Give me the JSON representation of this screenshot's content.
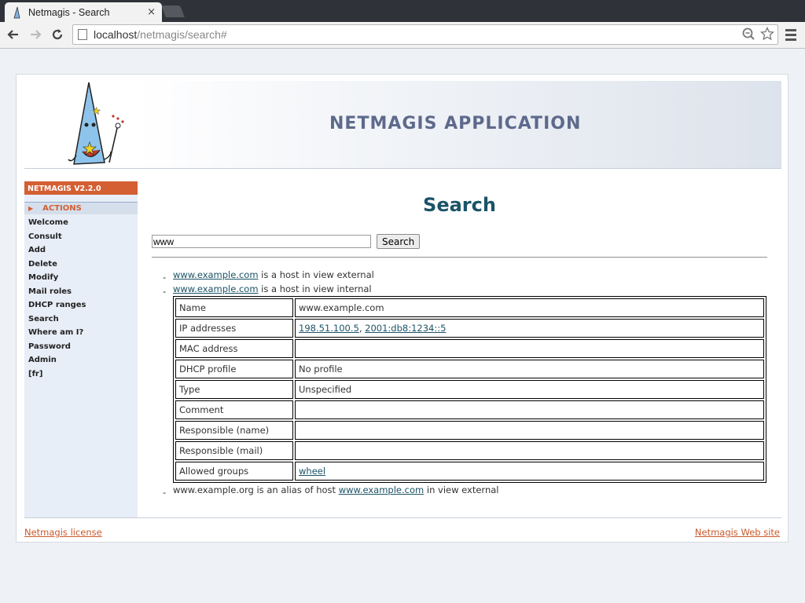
{
  "browser": {
    "tab_title": "Netmagis - Search",
    "tab_close": "×",
    "url_host": "localhost",
    "url_path": "/netmagis/search#"
  },
  "banner": {
    "app_title": "NETMAGIS APPLICATION"
  },
  "sidebar": {
    "version": "NETMAGIS V2.2.0",
    "section": "ACTIONS",
    "items": [
      "Welcome",
      "Consult",
      "Add",
      "Delete",
      "Modify",
      "Mail roles",
      "DHCP ranges",
      "Search",
      "Where am I?",
      "Password",
      "Admin",
      "[fr]"
    ]
  },
  "main": {
    "title": "Search",
    "search_value": "www",
    "search_button": "Search",
    "results": [
      {
        "link": "www.example.com",
        "text": " is a host in view external"
      },
      {
        "link": "www.example.com",
        "text": " is a host in view internal"
      }
    ],
    "table": {
      "rows": [
        {
          "key": "Name",
          "value": "www.example.com"
        },
        {
          "key": "IP addresses",
          "links": [
            "198.51.100.5",
            "2001:db8:1234::5"
          ],
          "sep": ", "
        },
        {
          "key": "MAC address",
          "value": ""
        },
        {
          "key": "DHCP profile",
          "value": "No profile"
        },
        {
          "key": "Type",
          "value": "Unspecified"
        },
        {
          "key": "Comment",
          "value": ""
        },
        {
          "key": "Responsible (name)",
          "value": ""
        },
        {
          "key": "Responsible (mail)",
          "value": ""
        },
        {
          "key": "Allowed groups",
          "links": [
            "wheel"
          ]
        }
      ]
    },
    "alias": {
      "prefix": "www.example.org is an alias of host ",
      "link": "www.example.com",
      "suffix": " in view external"
    }
  },
  "footer": {
    "left": "Netmagis license",
    "right": "Netmagis Web site"
  },
  "colors": {
    "accent": "#d35f32",
    "title": "#1b5367",
    "banner_text": "#5e6a8c"
  }
}
